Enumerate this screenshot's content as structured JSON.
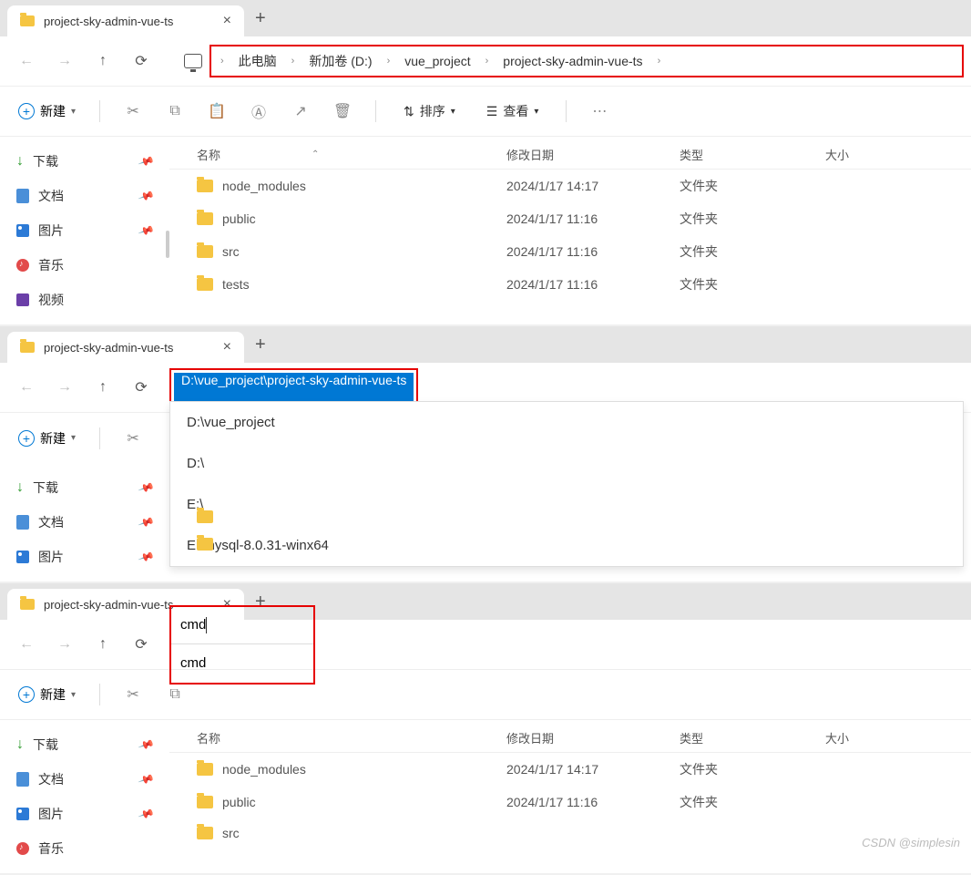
{
  "tab": {
    "title": "project-sky-admin-vue-ts"
  },
  "breadcrumb": [
    "此电脑",
    "新加卷 (D:)",
    "vue_project",
    "project-sky-admin-vue-ts"
  ],
  "toolbar": {
    "new_label": "新建",
    "sort_label": "排序",
    "view_label": "查看"
  },
  "sidebar": {
    "items": [
      {
        "label": "下载",
        "icon": "download"
      },
      {
        "label": "文档",
        "icon": "doc"
      },
      {
        "label": "图片",
        "icon": "img"
      },
      {
        "label": "音乐",
        "icon": "music"
      },
      {
        "label": "视频",
        "icon": "vid"
      }
    ]
  },
  "list": {
    "headers": {
      "name": "名称",
      "date": "修改日期",
      "type": "类型",
      "size": "大小"
    },
    "rows": [
      {
        "name": "node_modules",
        "date": "2024/1/17 14:17",
        "type": "文件夹"
      },
      {
        "name": "public",
        "date": "2024/1/17 11:16",
        "type": "文件夹"
      },
      {
        "name": "src",
        "date": "2024/1/17 11:16",
        "type": "文件夹"
      },
      {
        "name": "tests",
        "date": "2024/1/17 11:16",
        "type": "文件夹"
      }
    ]
  },
  "window2": {
    "address_input": "D:\\vue_project\\project-sky-admin-vue-ts",
    "dropdown": [
      "D:\\vue_project",
      "D:\\",
      "E:\\",
      "E:\\mysql-8.0.31-winx64"
    ],
    "sidebar": [
      "下载",
      "文档",
      "图片"
    ]
  },
  "window3": {
    "address_input": "cmd",
    "dropdown": [
      "cmd"
    ],
    "sidebar": [
      "下载",
      "文档",
      "图片",
      "音乐"
    ],
    "rows": [
      {
        "name": "node_modules",
        "date": "2024/1/17 14:17",
        "type": "文件夹"
      },
      {
        "name": "public",
        "date": "2024/1/17 11:16",
        "type": "文件夹"
      },
      {
        "name": "src",
        "date": "",
        "type": ""
      }
    ]
  },
  "watermark": "CSDN @simplesin"
}
